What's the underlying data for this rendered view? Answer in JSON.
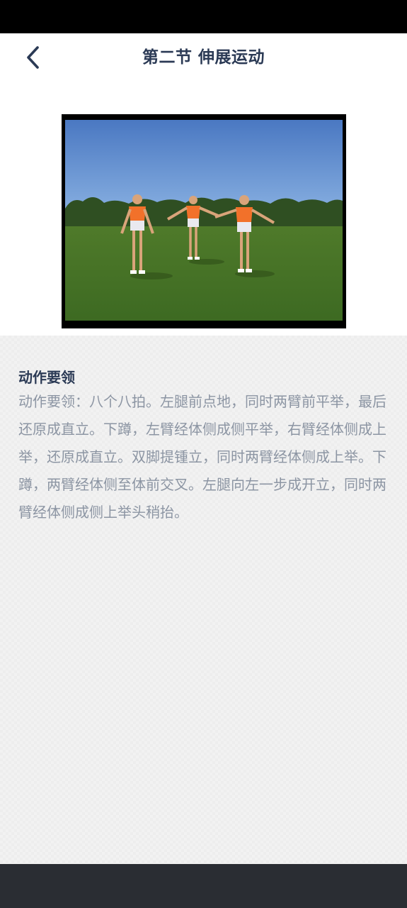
{
  "header": {
    "title": "第二节 伸展运动",
    "back_icon": "chevron-left-icon"
  },
  "video": {
    "description_icon": "video-thumbnail"
  },
  "section": {
    "title": "动作要领",
    "body": "动作要领：八个八拍。左腿前点地，同时两臂前平举，最后还原成直立。下蹲，左臂经体侧成侧平举，右臂经体侧成上举，还原成直立。双脚提锺立，同时两臂经体侧成上举。下蹲，两臂经体侧至体前交叉。左腿向左一步成开立，同时两臂经体侧成侧上举头稍抬。"
  },
  "colors": {
    "title": "#2b3a55",
    "body_text": "#8c95a3",
    "bottom_bar": "#2a2d33"
  }
}
